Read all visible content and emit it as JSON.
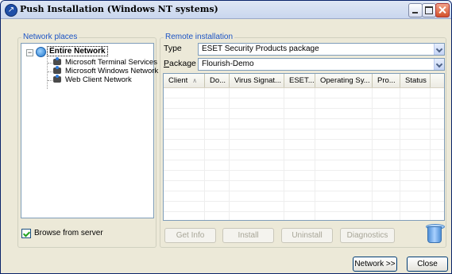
{
  "window": {
    "title": "Push Installation (Windows NT systems)"
  },
  "network_places": {
    "label": "Network places",
    "root": "Entire Network",
    "items": [
      "Microsoft Terminal Services",
      "Microsoft Windows Network",
      "Web Client Network"
    ],
    "browse_from_server": {
      "label": "Browse from server",
      "checked": true
    }
  },
  "remote_installation": {
    "label": "Remote installation",
    "type": {
      "label": "Type",
      "value": "ESET Security Products package"
    },
    "package": {
      "label": "Package",
      "value": "Flourish-Demo"
    },
    "table": {
      "columns": [
        "Client",
        "Do...",
        "Virus Signat...",
        "ESET...",
        "Operating Sy...",
        "Pro...",
        "Status"
      ],
      "rows": []
    },
    "buttons": {
      "get_info": "Get Info",
      "install": "Install",
      "uninstall": "Uninstall",
      "diagnostics": "Diagnostics"
    }
  },
  "footer": {
    "network": "Network >>",
    "close": "Close"
  }
}
